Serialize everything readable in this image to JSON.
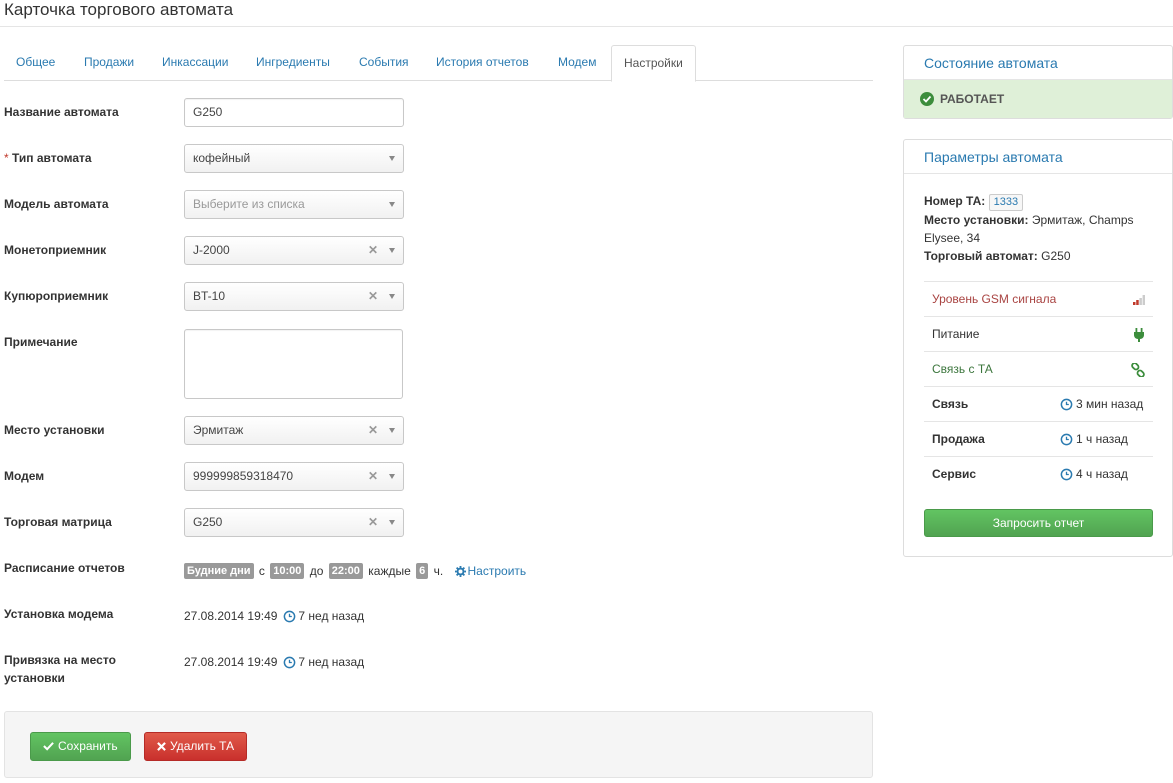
{
  "page": {
    "title": "Карточка торгового автомата"
  },
  "tabs": [
    {
      "label": "Общее"
    },
    {
      "label": "Продажи"
    },
    {
      "label": "Инкассации"
    },
    {
      "label": "Ингредиенты"
    },
    {
      "label": "События"
    },
    {
      "label": "История отчетов"
    },
    {
      "label": "Модем"
    },
    {
      "label": "Настройки",
      "active": true
    }
  ],
  "form": {
    "name": {
      "label": "Название автомата",
      "value": "G250"
    },
    "type": {
      "required_mark": "*",
      "label": "Тип автомата",
      "value": "кофейный"
    },
    "model": {
      "label": "Модель автомата",
      "placeholder": "Выберите из списка"
    },
    "coin": {
      "label": "Монетоприемник",
      "value": "J-2000"
    },
    "bill": {
      "label": "Купюроприемник",
      "value": "BT-10"
    },
    "note": {
      "label": "Примечание",
      "value": ""
    },
    "location": {
      "label": "Место установки",
      "value": "Эрмитаж"
    },
    "modem": {
      "label": "Модем",
      "value": "999999859318470"
    },
    "matrix": {
      "label": "Торговая матрица",
      "value": "G250"
    },
    "schedule": {
      "label": "Расписание отчетов",
      "days": "Будние дни",
      "from_word": "с",
      "from": "10:00",
      "to_word": "до",
      "to": "22:00",
      "every_word": "каждые",
      "every": "6",
      "unit": "ч.",
      "configure": "Настроить"
    },
    "modem_install": {
      "label": "Установка модема",
      "date": "27.08.2014 19:49",
      "ago": "7 нед назад"
    },
    "location_bind": {
      "label": "Привязка на место установки",
      "date": "27.08.2014 19:49",
      "ago": "7 нед назад"
    }
  },
  "actions": {
    "save": "Сохранить",
    "delete": "Удалить ТА"
  },
  "status_panel": {
    "title": "Состояние автомата",
    "status": "РАБОТАЕТ"
  },
  "params_panel": {
    "title": "Параметры автомата",
    "number_label": "Номер ТА:",
    "number": "1333",
    "location_label": "Место установки:",
    "location": "Эрмитаж, Champs Elysee, 34",
    "machine_label": "Торговый автомат:",
    "machine": "G250",
    "rows": {
      "gsm": "Уровень GSM сигнала",
      "power": "Питание",
      "link": "Связь с ТА",
      "conn": {
        "label": "Связь",
        "value": "3 мин назад"
      },
      "sale": {
        "label": "Продажа",
        "value": "1 ч назад"
      },
      "service": {
        "label": "Сервис",
        "value": "4 ч назад"
      }
    },
    "report_button": "Запросить отчет"
  },
  "colors": {
    "link": "#2a7ab0",
    "success": "#51a351",
    "danger": "#c9302c",
    "status_bg": "#dff0d8"
  }
}
